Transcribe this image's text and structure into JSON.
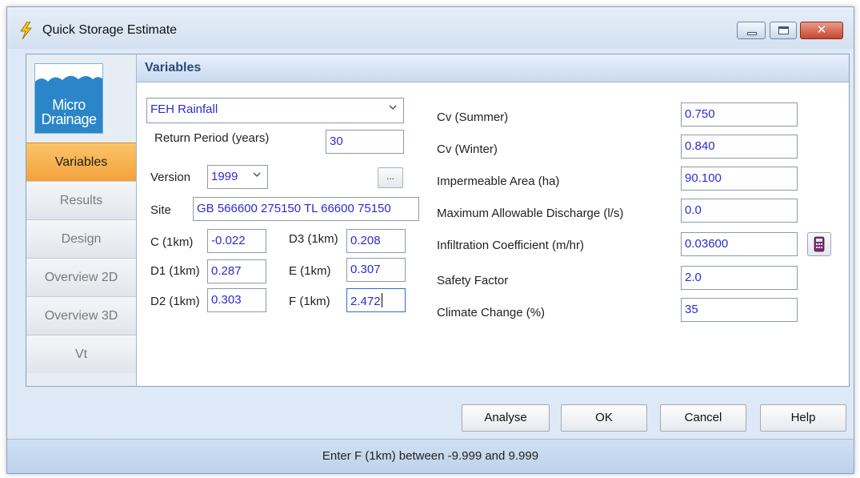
{
  "window": {
    "title": "Quick Storage Estimate",
    "controls": [
      "minimize",
      "maximize",
      "close"
    ],
    "close_glyph": "✕"
  },
  "logo": {
    "line1": "Micro",
    "line2": "Drainage"
  },
  "sidebar": {
    "items": [
      {
        "label": "Variables",
        "active": true
      },
      {
        "label": "Results",
        "active": false
      },
      {
        "label": "Design",
        "active": false
      },
      {
        "label": "Overview 2D",
        "active": false
      },
      {
        "label": "Overview 3D",
        "active": false
      },
      {
        "label": "Vt",
        "active": false
      }
    ]
  },
  "panel": {
    "title": "Variables"
  },
  "rainfall": {
    "method": "FEH Rainfall",
    "return_period_label": "Return Period (years)",
    "return_period": "30",
    "version_label": "Version",
    "version": "1999",
    "browse_label": "...",
    "site_label": "Site",
    "site": "GB 566600 275150 TL 66600 75150",
    "c_label": "C (1km)",
    "c": "-0.022",
    "d1_label": "D1 (1km)",
    "d1": "0.287",
    "d2_label": "D2 (1km)",
    "d2": "0.303",
    "d3_label": "D3 (1km)",
    "d3": "0.208",
    "e_label": "E (1km)",
    "e": "0.307",
    "f_label": "F (1km)",
    "f": "2.472"
  },
  "parameters": {
    "cv_summer_label": "Cv (Summer)",
    "cv_summer": "0.750",
    "cv_winter_label": "Cv (Winter)",
    "cv_winter": "0.840",
    "imp_area_label": "Impermeable Area (ha)",
    "imp_area": "90.100",
    "max_discharge_label": "Maximum Allowable Discharge (l/s)",
    "max_discharge": "0.0",
    "infiltration_label": "Infiltration Coefficient (m/hr)",
    "infiltration": "0.03600",
    "safety_label": "Safety Factor",
    "safety": "2.0",
    "climate_label": "Climate Change (%)",
    "climate": "35"
  },
  "buttons": {
    "analyse": "Analyse",
    "ok": "OK",
    "cancel": "Cancel",
    "help": "Help"
  },
  "status": "Enter F (1km) between -9.999 and 9.999",
  "colors": {
    "accent": "#f3a23a",
    "value_text": "#2b2bd0",
    "header_text": "#2c4a78",
    "status_bg": "#c8dbf0"
  }
}
